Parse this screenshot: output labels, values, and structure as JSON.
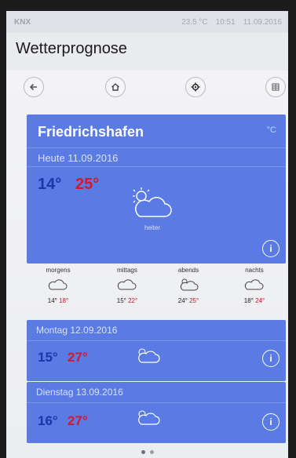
{
  "statusbar": {
    "brand": "KNX",
    "sensor": "23.5 °C",
    "time": "10:51",
    "date": "11.09.2016"
  },
  "header": {
    "title": "Wetterprognose"
  },
  "toolbar": [
    "back-icon",
    "home-icon",
    "settings-icon",
    "grid-icon"
  ],
  "today": {
    "city": "Friedrichshafen",
    "city_suffix": "°C",
    "date_label": "Heute 11.09.2016",
    "min": "14°",
    "max": "25°",
    "condition": "heiter",
    "info": "i"
  },
  "dayparts": [
    {
      "label": "morgens",
      "min": "14°",
      "max": "18°"
    },
    {
      "label": "mittags",
      "min": "15°",
      "max": "22°"
    },
    {
      "label": "abends",
      "min": "24°",
      "max": "25°"
    },
    {
      "label": "nachts",
      "min": "18°",
      "max": "24°"
    }
  ],
  "forecast": [
    {
      "label": "Montag 12.09.2016",
      "min": "15°",
      "max": "27°",
      "info": "i"
    },
    {
      "label": "Dienstag 13.09.2016",
      "min": "16°",
      "max": "27°",
      "info": "i"
    }
  ],
  "colors": {
    "card": "#5a7be3",
    "min_temp": "#1e35a8",
    "max_temp": "#d1192e"
  }
}
